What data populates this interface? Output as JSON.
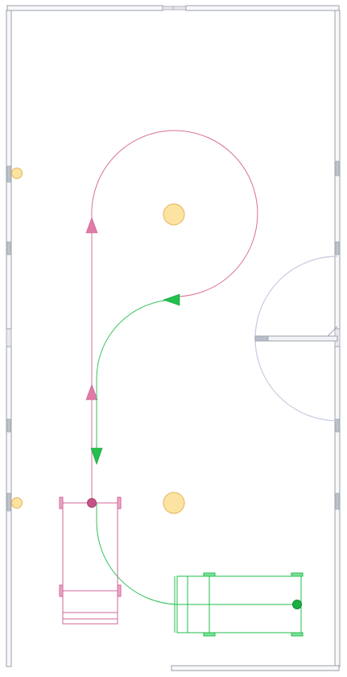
{
  "scene": {
    "type": "top-down floor plan with robot paths",
    "colors": {
      "background": "#ffffff",
      "wall_fill": "#f7f8fa",
      "wall_stroke": "#9aa0a8",
      "door_arc": "#c8cbe0",
      "pink_path": "#d8708f",
      "pink_body": "#d1669a",
      "green_path": "#35c35b",
      "green_body": "#1fbf4a",
      "marker_fill": "#fde3a1",
      "marker_stroke": "#e3b25a"
    },
    "icons": [
      "triangle-arrow-icon",
      "circle-marker-icon"
    ]
  }
}
